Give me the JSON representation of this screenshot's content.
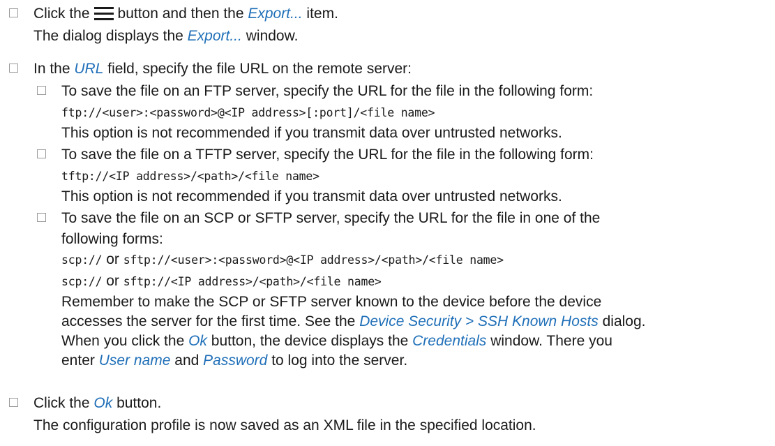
{
  "steps": [
    {
      "l1_before": "Click the",
      "l1_after": "button and then the",
      "l1_ui": "Export...",
      "l1_end": "item.",
      "l2_before": "The dialog displays the",
      "l2_ui": "Export...",
      "l2_end": "window.",
      "icon": "hamburger-menu-icon"
    },
    {
      "l1_before": "In the",
      "l1_ui": "URL",
      "l1_end": "field, specify the file URL on the remote server:",
      "subs": [
        {
          "text": "To save the file on an FTP server, specify the URL for the file in the following form:",
          "code": "ftp://<user>:<password>@<IP address>[:port]/<file name>",
          "note": "This option is not recommended if you transmit data over untrusted networks."
        },
        {
          "text": "To save the file on a TFTP server, specify the URL for the file in the following form:",
          "code": "tftp://<IP address>/<path>/<file name>",
          "note": "This option is not recommended if you transmit data over untrusted networks."
        },
        {
          "text1": "To save the file on an SCP or SFTP server, specify the URL for the file in one of the",
          "text2": "following forms:",
          "code1a": "scp://",
          "code1_or": "or",
          "code1b": "sftp://<user>:<password>@<IP address>/<path>/<file name>",
          "code2a": "scp://",
          "code2_or": "or",
          "code2b": "sftp://<IP address>/<path>/<file name>",
          "r1": "Remember to make the SCP or SFTP server known to the device before the device",
          "r2_before": "accesses the server for the first time. See the",
          "r2_ui": "Device Security > SSH Known Hosts",
          "r2_end": "dialog.",
          "r3_before": "When you click the",
          "r3_ui1": "Ok",
          "r3_mid": "button, the device displays the",
          "r3_ui2": "Credentials",
          "r3_end": "window. There you",
          "r4_before": "enter",
          "r4_ui1": "User name",
          "r4_mid": "and",
          "r4_ui2": "Password",
          "r4_end": "to log into the server."
        }
      ]
    },
    {
      "l1_before": "Click the",
      "l1_ui": "Ok",
      "l1_end": "button.",
      "l2": "The configuration profile is now saved as an XML file in the specified location."
    }
  ]
}
